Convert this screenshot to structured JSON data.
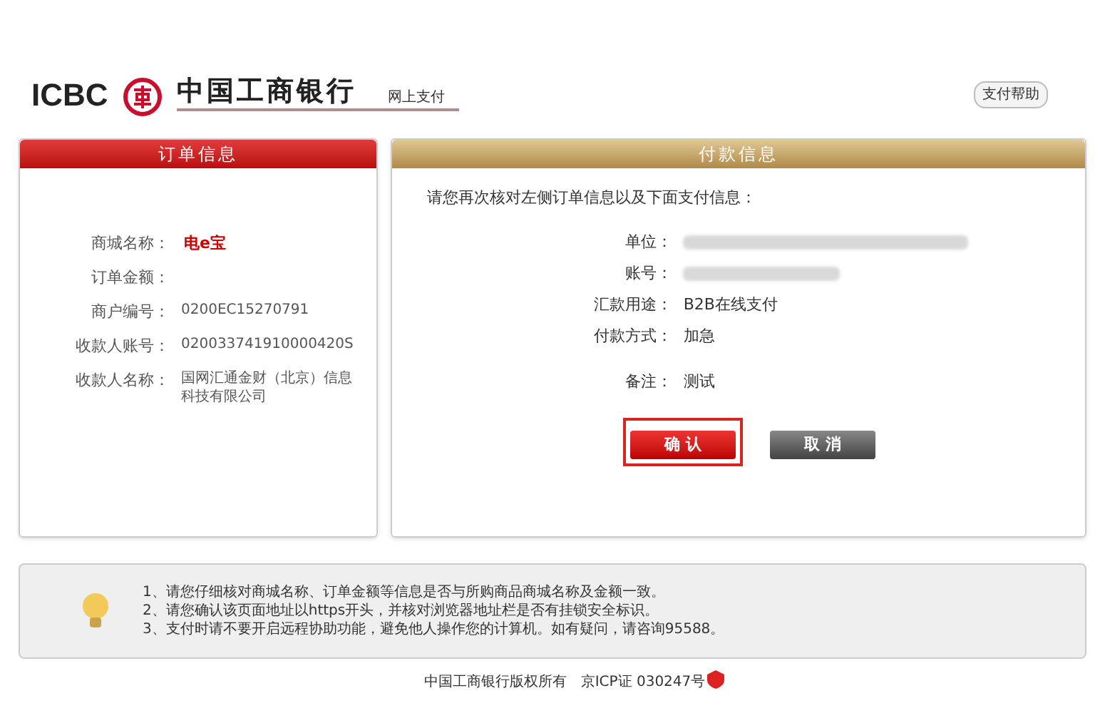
{
  "header": {
    "logo_latin": "ICBC",
    "bank_name": "中国工商银行",
    "service": "网上支付",
    "help_button": "支付帮助"
  },
  "order_panel": {
    "title": "订单信息",
    "rows": [
      {
        "label": "商城名称：",
        "value": "电e宝",
        "kind": "brand"
      },
      {
        "label": "订单金额：",
        "kind": "empty"
      },
      {
        "label": "商户编号：",
        "value": "0200EC15270791",
        "kind": "plain"
      },
      {
        "label": "收款人账号：",
        "value": "020033741910000420S",
        "kind": "plain"
      },
      {
        "label": "收款人名称：",
        "value": "国网汇通金财（北京）信息科技有限公司",
        "kind": "plain"
      }
    ]
  },
  "payment_panel": {
    "title": "付款信息",
    "instruction": "请您再次核对左侧订单信息以及下面支付信息：",
    "rows": [
      {
        "label": "单位：",
        "kind": "redacted"
      },
      {
        "label": "账号：",
        "kind": "redacted"
      },
      {
        "label": "汇款用途：",
        "value": "B2B在线支付",
        "kind": "plain"
      },
      {
        "label": "付款方式：",
        "value": "加急",
        "kind": "plain"
      },
      {
        "label": "备注：",
        "value": "测试",
        "kind": "plain"
      }
    ],
    "buttons": [
      {
        "label": "确 认",
        "kind": "primary",
        "highlighted": true
      },
      {
        "label": "取 消",
        "kind": "secondary",
        "highlighted": false
      }
    ]
  },
  "notice": {
    "lines": [
      "1、请您仔细核对商城名称、订单金额等信息是否与所购商品商城名称及金额一致。",
      "2、请您确认该页面地址以https开头，并核对浏览器地址栏是否有挂锁安全标识。",
      "3、支付时请不要开启远程协助功能，避免他人操作您的计算机。如有疑问，请咨询95588。"
    ]
  },
  "footer": {
    "copyright": "中国工商银行版权所有",
    "icp": "京ICP证 030247号"
  }
}
